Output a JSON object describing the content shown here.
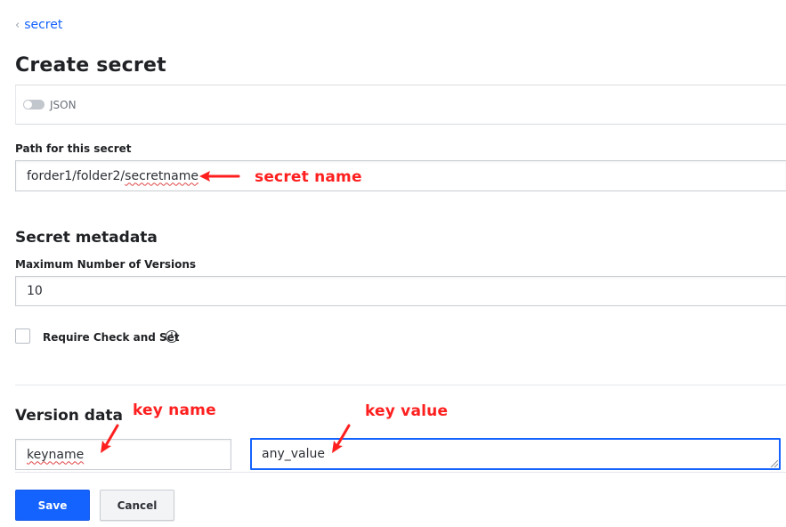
{
  "breadcrumb": {
    "label": "secret"
  },
  "page_title": "Create secret",
  "json_toggle": {
    "label": "JSON",
    "enabled": false
  },
  "path": {
    "label": "Path for this secret",
    "value": "forder1/folder2/secretname"
  },
  "metadata": {
    "heading": "Secret metadata",
    "max_versions_label": "Maximum Number of Versions",
    "max_versions_value": "10",
    "cas_label": "Require Check and Set",
    "cas_checked": false
  },
  "version_data": {
    "heading": "Version data",
    "key": "keyname",
    "value": "any_value"
  },
  "actions": {
    "save": "Save",
    "cancel": "Cancel"
  },
  "annotations": {
    "secret_name": "secret name",
    "key_name": "key name",
    "key_value": "key value",
    "color": "#ff1f1f"
  },
  "colors": {
    "primary": "#1563ff"
  }
}
